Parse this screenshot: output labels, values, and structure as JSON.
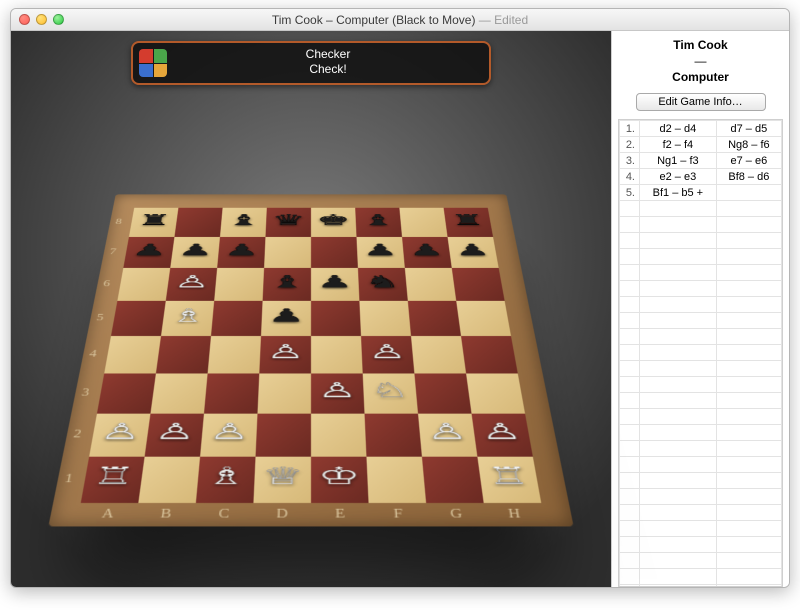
{
  "window": {
    "title_main": "Tim Cook – Computer   (Black to Move)",
    "title_status": " — Edited"
  },
  "notification": {
    "line1": "Checker",
    "line2": "Check!",
    "icon_colors": [
      "#d43c2e",
      "#4aa54a",
      "#3a6fcf",
      "#e6a63a"
    ]
  },
  "players": {
    "white": "Tim Cook",
    "vs": "—",
    "black": "Computer"
  },
  "edit_button_label": "Edit Game Info…",
  "board": {
    "files": [
      "A",
      "B",
      "C",
      "D",
      "E",
      "F",
      "G",
      "H"
    ],
    "ranks": [
      "8",
      "7",
      "6",
      "5",
      "4",
      "3",
      "2",
      "1"
    ],
    "position": {
      "a8": "br",
      "c8": "bb",
      "d8": "bq",
      "e8": "bk",
      "f8": "bb",
      "h8": "br",
      "a7": "bp",
      "b7": "bp",
      "c7": "bp",
      "f7": "bp",
      "g7": "bp",
      "h7": "bp",
      "b6": "wp",
      "d6": "bb",
      "e6": "bp",
      "f6": "bn",
      "b5": "wb",
      "d5": "bp",
      "d4": "wp",
      "f4": "wp",
      "e3": "wp",
      "f3": "wn",
      "a2": "wp",
      "b2": "wp",
      "c2": "wp",
      "g2": "wp",
      "h2": "wp",
      "a1": "wr",
      "c1": "wb",
      "d1": "wq",
      "e1": "wk",
      "h1": "wr"
    }
  },
  "moves": [
    {
      "n": "1.",
      "w": "d2 – d4",
      "b": "d7 – d5"
    },
    {
      "n": "2.",
      "w": "f2 – f4",
      "b": "Ng8 – f6"
    },
    {
      "n": "3.",
      "w": "Ng1 – f3",
      "b": "e7 – e6"
    },
    {
      "n": "4.",
      "w": "e2 – e3",
      "b": "Bf8 – d6"
    },
    {
      "n": "5.",
      "w": "Bf1 – b5 +",
      "b": ""
    }
  ],
  "empty_rows": 25,
  "glyphs": {
    "wk": "♔",
    "wq": "♕",
    "wr": "♖",
    "wb": "♗",
    "wn": "♘",
    "wp": "♙",
    "bk": "♚",
    "bq": "♛",
    "br": "♜",
    "bb": "♝",
    "bn": "♞",
    "bp": "♟"
  }
}
